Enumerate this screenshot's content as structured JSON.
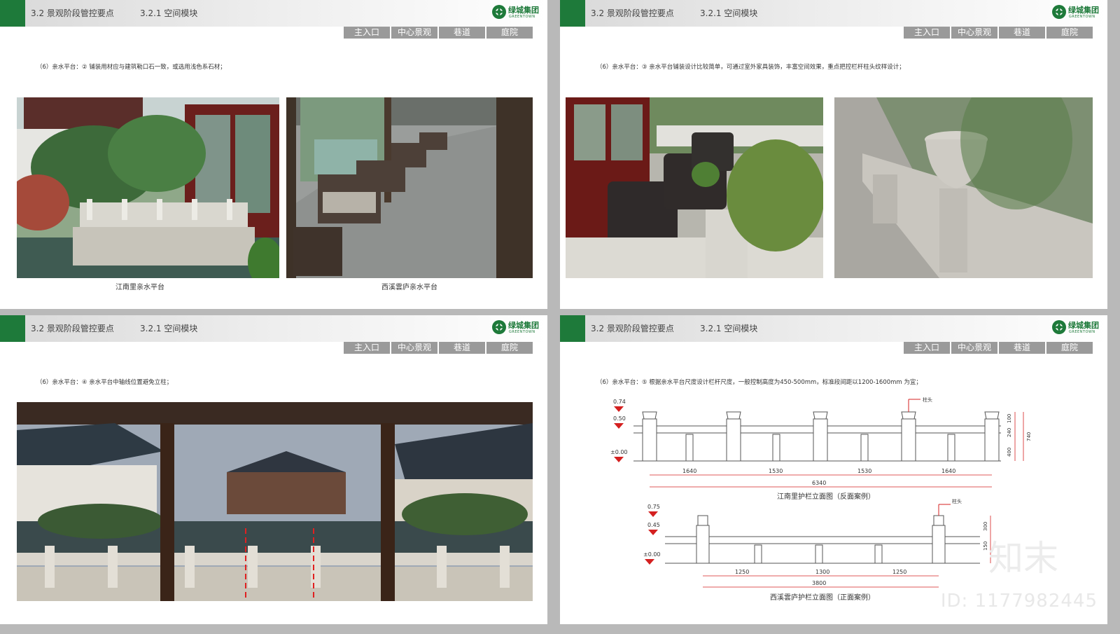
{
  "header": {
    "section": "3.2 景观阶段管控要点",
    "subsection": "3.2.1 空间模块",
    "logo_cn": "绿城集团",
    "logo_en": "GREENTOWN"
  },
  "tabs": [
    "主入口",
    "中心景观",
    "巷道",
    "庭院"
  ],
  "slides": [
    {
      "note": "（6）亲水平台：② 铺装用材应与建筑勒口石一致，或选用浅色系石材；",
      "captions": [
        "江南里亲水平台",
        "西溪雲庐亲水平台"
      ]
    },
    {
      "note": "（6）亲水平台：③ 亲水平台铺装设计比较简单，可通过室外家具装饰，丰富空间效果，重点把控栏杆柱头纹样设计；"
    },
    {
      "note": "（6）亲水平台：④ 亲水平台中轴线位置避免立柱；"
    },
    {
      "note": "（6）亲水平台：⑤ 根据亲水平台尺度设计栏杆尺度，一般控制高度为450-500mm，标准段间距以1200-1600mm 为宜；",
      "drawing1": {
        "levels": [
          "0.74",
          "0.50",
          "±0.00"
        ],
        "post_label": "柱头",
        "dims": [
          "1640",
          "1530",
          "1530",
          "1640"
        ],
        "total": "6340",
        "vdims": [
          "100",
          "240",
          "400",
          "740"
        ],
        "title": "江南里护栏立面图（反面案例）"
      },
      "drawing2": {
        "levels": [
          "0.75",
          "0.45",
          "±0.00"
        ],
        "post_label": "柱头",
        "dims": [
          "1250",
          "1300",
          "1250"
        ],
        "total": "3800",
        "vdims": [
          "300",
          "150"
        ],
        "title": "西溪雲庐护栏立面图（正面案例）"
      }
    }
  ],
  "watermark": {
    "text": "知末",
    "id": "ID: 1177982445"
  }
}
